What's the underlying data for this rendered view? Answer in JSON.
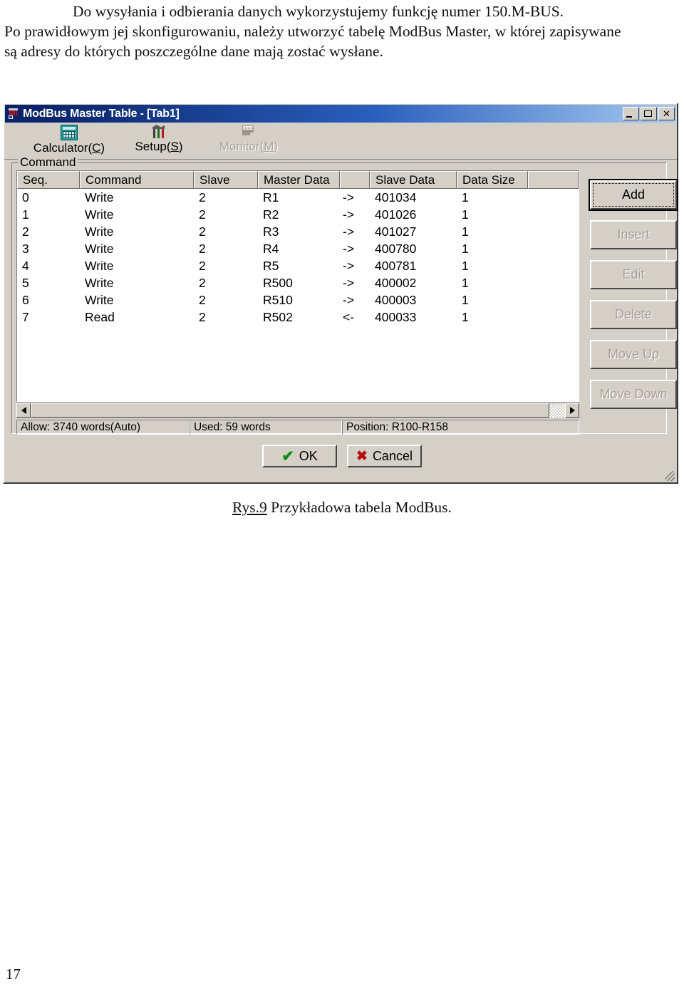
{
  "document": {
    "paragraph_lines": [
      "Do wysyłania i odbierania danych wykorzystujemy funkcję numer 150.M-BUS.",
      "Po prawidłowym jej skonfigurowaniu, należy utworzyć tabelę ModBus Master, w której zapisywane",
      "są adresy do których poszczególne dane mają zostać wysłane."
    ],
    "figure_caption_ref": "Rys.9",
    "figure_caption_text": " Przykładowa tabela ModBus.",
    "page_number": "17"
  },
  "dialog": {
    "title": "ModBus Master Table - [Tab1]",
    "title_icon": "modbus-table-icon",
    "window_controls": [
      {
        "name": "minimize",
        "label": ""
      },
      {
        "name": "maximize",
        "label": ""
      },
      {
        "name": "close",
        "label": "✕"
      }
    ],
    "toolbar": [
      {
        "name": "calculator",
        "label": "Calculator(",
        "accel": "C",
        "label_end": ")",
        "icon": "calculator-icon",
        "enabled": true
      },
      {
        "name": "setup",
        "label": "Setup(",
        "accel": "S",
        "label_end": ")",
        "icon": "tools-icon",
        "enabled": true
      },
      {
        "name": "monitor",
        "label": "Monitor(",
        "accel": "M",
        "label_end": ")",
        "icon": "monitor-icon",
        "enabled": false
      }
    ],
    "group": {
      "label": "Command"
    },
    "table": {
      "columns": [
        "Seq.",
        "Command",
        "Slave",
        "Master Data",
        "",
        "Slave Data",
        "Data Size"
      ],
      "rows": [
        {
          "seq": "0",
          "command": "Write",
          "slave": "2",
          "master_data": "R1",
          "dir": "->",
          "slave_data": "401034",
          "data_size": "1"
        },
        {
          "seq": "1",
          "command": "Write",
          "slave": "2",
          "master_data": "R2",
          "dir": "->",
          "slave_data": "401026",
          "data_size": "1"
        },
        {
          "seq": "2",
          "command": "Write",
          "slave": "2",
          "master_data": "R3",
          "dir": "->",
          "slave_data": "401027",
          "data_size": "1"
        },
        {
          "seq": "3",
          "command": "Write",
          "slave": "2",
          "master_data": "R4",
          "dir": "->",
          "slave_data": "400780",
          "data_size": "1"
        },
        {
          "seq": "4",
          "command": "Write",
          "slave": "2",
          "master_data": "R5",
          "dir": "->",
          "slave_data": "400781",
          "data_size": "1"
        },
        {
          "seq": "5",
          "command": "Write",
          "slave": "2",
          "master_data": "R500",
          "dir": "->",
          "slave_data": "400002",
          "data_size": "1"
        },
        {
          "seq": "6",
          "command": "Write",
          "slave": "2",
          "master_data": "R510",
          "dir": "->",
          "slave_data": "400003",
          "data_size": "1"
        },
        {
          "seq": "7",
          "command": "Read",
          "slave": "2",
          "master_data": "R502",
          "dir": "<-",
          "slave_data": "400033",
          "data_size": "1"
        }
      ]
    },
    "side_buttons": [
      {
        "name": "add",
        "label": "Add",
        "enabled": true,
        "focused": true
      },
      {
        "name": "insert",
        "label": "Insert",
        "enabled": false,
        "focused": false
      },
      {
        "name": "edit",
        "label": "Edit",
        "enabled": false,
        "focused": false
      },
      {
        "name": "delete",
        "label": "Delete",
        "enabled": false,
        "focused": false
      },
      {
        "name": "move-up",
        "label": "Move Up",
        "enabled": false,
        "focused": false
      },
      {
        "name": "move-down",
        "label": "Move Down",
        "enabled": false,
        "focused": false
      }
    ],
    "status_bar": {
      "allow": "Allow: 3740 words(Auto)",
      "used": "Used: 59 words",
      "position": "Position: R100-R158"
    },
    "footer_buttons": [
      {
        "name": "ok",
        "label": "OK",
        "icon": "check-icon",
        "glyph": "✔"
      },
      {
        "name": "cancel",
        "label": "Cancel",
        "icon": "x-icon",
        "glyph": "✖"
      }
    ]
  },
  "colors": {
    "dialog_face": "#d4d0c8",
    "title_left": "#0a246a",
    "title_right": "#a6caf0",
    "ok_check": "#108a10",
    "cancel_x": "#b80d0d",
    "disabled_text": "#a5a19a"
  }
}
